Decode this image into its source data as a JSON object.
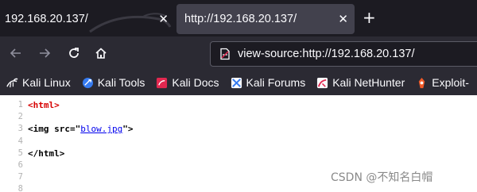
{
  "tabs": [
    {
      "title": "192.168.20.137/",
      "close_label": "✕",
      "active": false
    },
    {
      "title": "http://192.168.20.137/",
      "close_label": "✕",
      "active": true
    }
  ],
  "new_tab_label": "+",
  "nav": {
    "back_icon": "arrow-left-icon",
    "forward_icon": "arrow-right-icon",
    "reload_icon": "reload-icon",
    "home_icon": "home-icon"
  },
  "urlbar": {
    "value": "view-source:http://192.168.20.137/",
    "icon": "page-icon"
  },
  "bookmarks": [
    {
      "label": "Kali Linux",
      "icon": "kali-dragon-icon"
    },
    {
      "label": "Kali Tools",
      "icon": "kali-tools-icon"
    },
    {
      "label": "Kali Docs",
      "icon": "kali-docs-icon"
    },
    {
      "label": "Kali Forums",
      "icon": "kali-forums-icon"
    },
    {
      "label": "Kali NetHunter",
      "icon": "nethunter-icon"
    },
    {
      "label": "Exploit-",
      "icon": "exploit-db-icon"
    }
  ],
  "source": {
    "line_numbers": [
      "1",
      "2",
      "3",
      "4",
      "5",
      "6",
      "7",
      "8"
    ],
    "open_html": "<html>",
    "img_open": "<img src=\"",
    "img_src": "blow.jpg",
    "img_close": "\">",
    "close_html": "</html>"
  },
  "watermark": "CSDN @不知名白帽",
  "colors": {
    "tabstrip": "#1c1b22",
    "toolbar": "#2b2a33",
    "active_tab": "#42414d",
    "html_tag": "#d70000",
    "img_tag": "#881280",
    "link": "#0000ee"
  }
}
